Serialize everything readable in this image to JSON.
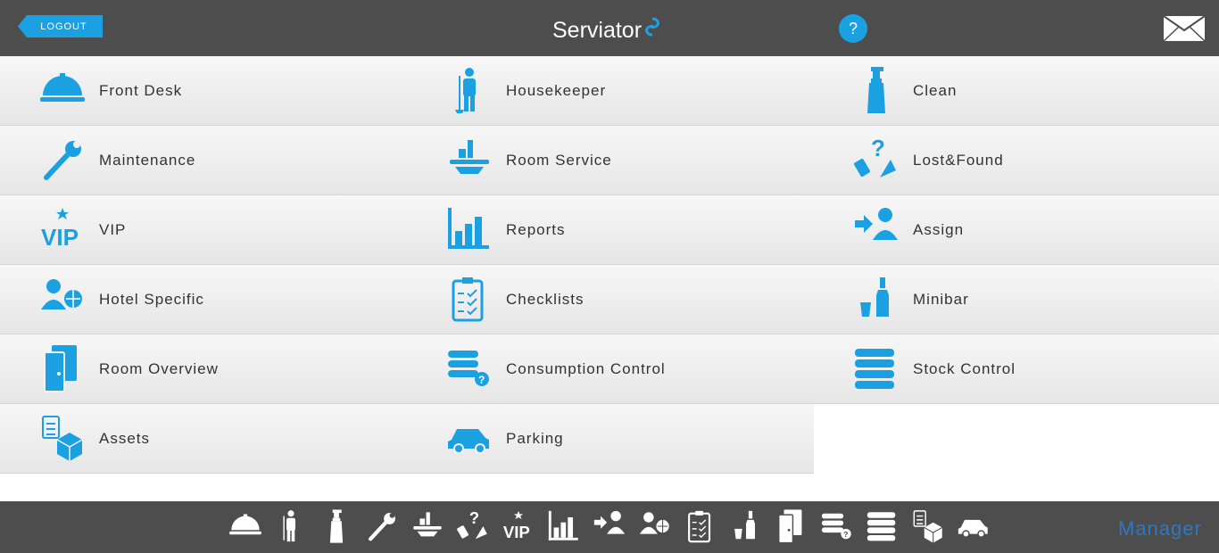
{
  "header": {
    "logout_label": "LOGOUT",
    "brand": "Serviator",
    "help_label": "?"
  },
  "tiles": [
    {
      "label": "Front Desk",
      "icon": "front-desk-bell-icon"
    },
    {
      "label": "Housekeeper",
      "icon": "housekeeper-icon"
    },
    {
      "label": "Clean",
      "icon": "spray-bottle-icon"
    },
    {
      "label": "Maintenance",
      "icon": "wrench-icon"
    },
    {
      "label": "Room Service",
      "icon": "room-service-tray-icon"
    },
    {
      "label": "Lost&Found",
      "icon": "lost-found-icon"
    },
    {
      "label": "VIP",
      "icon": "vip-icon"
    },
    {
      "label": "Reports",
      "icon": "bar-chart-icon"
    },
    {
      "label": "Assign",
      "icon": "assign-person-icon"
    },
    {
      "label": "Hotel Specific",
      "icon": "hotel-specific-globe-icon"
    },
    {
      "label": "Checklists",
      "icon": "clipboard-checklist-icon"
    },
    {
      "label": "Minibar",
      "icon": "minibar-bottle-icon"
    },
    {
      "label": "Room Overview",
      "icon": "door-icon"
    },
    {
      "label": "Consumption Control",
      "icon": "towels-question-icon"
    },
    {
      "label": "Stock Control",
      "icon": "towels-stack-icon"
    },
    {
      "label": "Assets",
      "icon": "assets-box-icon"
    },
    {
      "label": "Parking",
      "icon": "car-icon"
    }
  ],
  "footer": {
    "user_role": "Manager"
  },
  "colors": {
    "accent": "#1ba1e2",
    "bar": "#4d4d4d",
    "manager": "#2e78c2"
  }
}
